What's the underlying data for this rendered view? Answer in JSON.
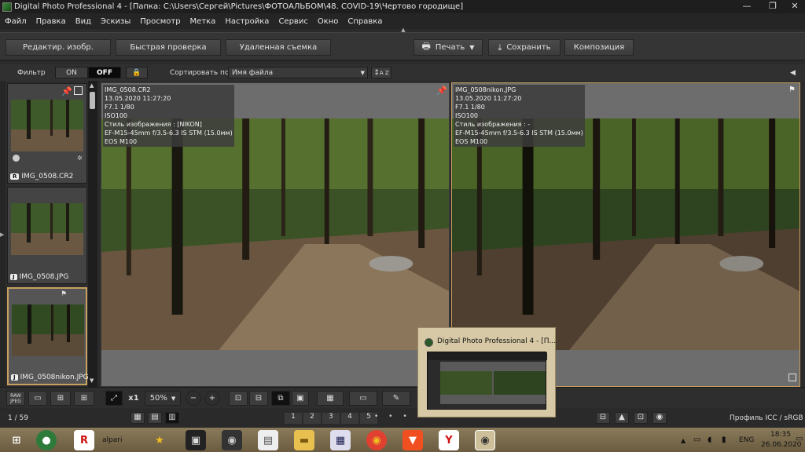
{
  "titlebar": {
    "title": "Digital Photo Professional 4 - [Папка: C:\\Users\\Сергей\\Pictures\\ФОТОАЛЬБОМ\\48. COVID-19\\Чертово городище]",
    "minimize": "—",
    "restore": "❐",
    "close": "✕"
  },
  "menu": [
    "Файл",
    "Правка",
    "Вид",
    "Эскизы",
    "Просмотр",
    "Метка",
    "Настройка",
    "Сервис",
    "Окно",
    "Справка"
  ],
  "toolbar": {
    "edit": "Редактир. изобр.",
    "quick_check": "Быстрая проверка",
    "remote": "Удаленная съемка",
    "print": "Печать",
    "save": "Сохранить",
    "compose": "Композиция"
  },
  "filterbar": {
    "filter": "Фильтр",
    "on": "ON",
    "off": "OFF",
    "sort_label": "Сортировать по:",
    "sort_value": "Имя файла",
    "sort_az": "A Z"
  },
  "thumbnails": [
    {
      "tag": "R",
      "name": "IMG_0508.CR2"
    },
    {
      "tag": "J",
      "name": "IMG_0508.JPG"
    },
    {
      "tag": "J",
      "name": "IMG_0508nikon.JPG"
    }
  ],
  "left_pane": {
    "info": [
      "IMG_0508.CR2",
      "13.05.2020 11:27:20",
      "F7.1 1/80",
      "ISO100",
      "Стиль изображения : [NIKON]",
      "EF-M15-45mm f/3.5-6.3 IS STM (15.0мм)",
      "EOS M100"
    ]
  },
  "right_pane": {
    "info": [
      "IMG_0508nikon.JPG",
      "13.05.2020 11:27:20",
      "F7.1 1/80",
      "ISO100",
      "Стиль изображения : -",
      "EF-M15-45mm f/3.5-6.3 IS STM (15.0мм)",
      "EOS M100"
    ]
  },
  "bottombar": {
    "raw_jpeg": "RAW JPEG",
    "zoom_x1": "x1",
    "zoom_value": "50%"
  },
  "status": {
    "count": "1 / 59",
    "ratings": [
      "1",
      "2",
      "3",
      "4",
      "5"
    ],
    "profile": "Профиль ICC / sRGB"
  },
  "preview": {
    "title": "Digital Photo Professional 4 - [П..."
  },
  "taskbar": {
    "alpari": "alpari",
    "lang": "ENG",
    "time": "18:35",
    "date": "26.06.2020"
  }
}
